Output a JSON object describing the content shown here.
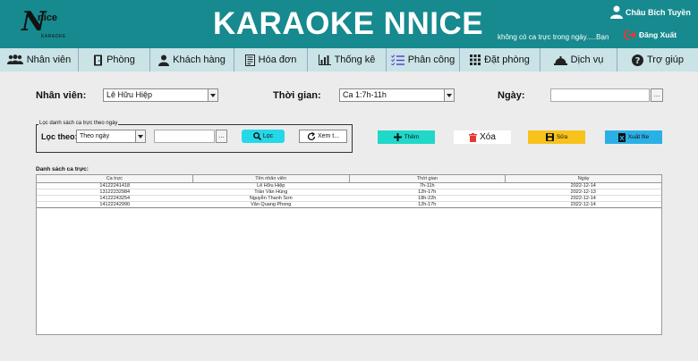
{
  "header": {
    "logo_main": "N",
    "logo_sub": "nice",
    "logo_tag": "KARAOKE",
    "title": "KARAOKE NNICE",
    "user_name": "Châu Bích Tuyền",
    "shift_message": "không có ca trực trong ngày.....Bạn",
    "logout_label": "Đăng Xuất"
  },
  "nav": [
    {
      "label": "Nhân viên",
      "icon": "users-icon"
    },
    {
      "label": "Phòng",
      "icon": "door-icon"
    },
    {
      "label": "Khách hàng",
      "icon": "customer-icon"
    },
    {
      "label": "Hóa đơn",
      "icon": "invoice-icon"
    },
    {
      "label": "Thống kê",
      "icon": "chart-icon"
    },
    {
      "label": "Phân công",
      "icon": "assign-list-icon"
    },
    {
      "label": "Đặt phòng",
      "icon": "grid-icon"
    },
    {
      "label": "Dịch vụ",
      "icon": "service-bell-icon"
    },
    {
      "label": "Trợ giúp",
      "icon": "help-icon"
    }
  ],
  "form": {
    "employee_label": "Nhân viên:",
    "employee_value": "Lê Hữu Hiệp",
    "time_label": "Thời gian:",
    "time_value": "Ca 1:7h-11h",
    "date_label": "Ngày:",
    "dots": "..."
  },
  "filter": {
    "group_title": "Lọc danh sách ca trực theo ngày",
    "filter_label": "Lọc theo:",
    "filter_value": "Theo ngày",
    "filter_button": "Lọc",
    "view_button": "Xem t..."
  },
  "actions": {
    "add": "Thêm",
    "delete": "Xóa",
    "edit": "Sửa",
    "export": "Xuất file"
  },
  "colors": {
    "header_bg": "#168a8e",
    "nav_bg": "#c9e3e6",
    "add_btn": "#1fd8c8",
    "edit_btn": "#f7c21b",
    "export_btn": "#2bb0e6",
    "filter_btn": "#25d8e8"
  },
  "table": {
    "label": "Danh sách ca trực:",
    "columns": [
      "Ca trực",
      "Tên nhân viên",
      "Thời gian",
      "Ngày"
    ],
    "rows": [
      [
        "14122241418",
        "Lê Hữu Hiệp",
        "7h-11h",
        "2022-12-14"
      ],
      [
        "13122232984",
        "Trần Văn Hùng",
        "12h-17h",
        "2022-12-13"
      ],
      [
        "14122243254",
        "Nguyễn Thanh Sơn",
        "18h-22h",
        "2022-12-14"
      ],
      [
        "14122242990",
        "Văn Quang Phong",
        "12h-17h",
        "2022-12-14"
      ]
    ]
  }
}
